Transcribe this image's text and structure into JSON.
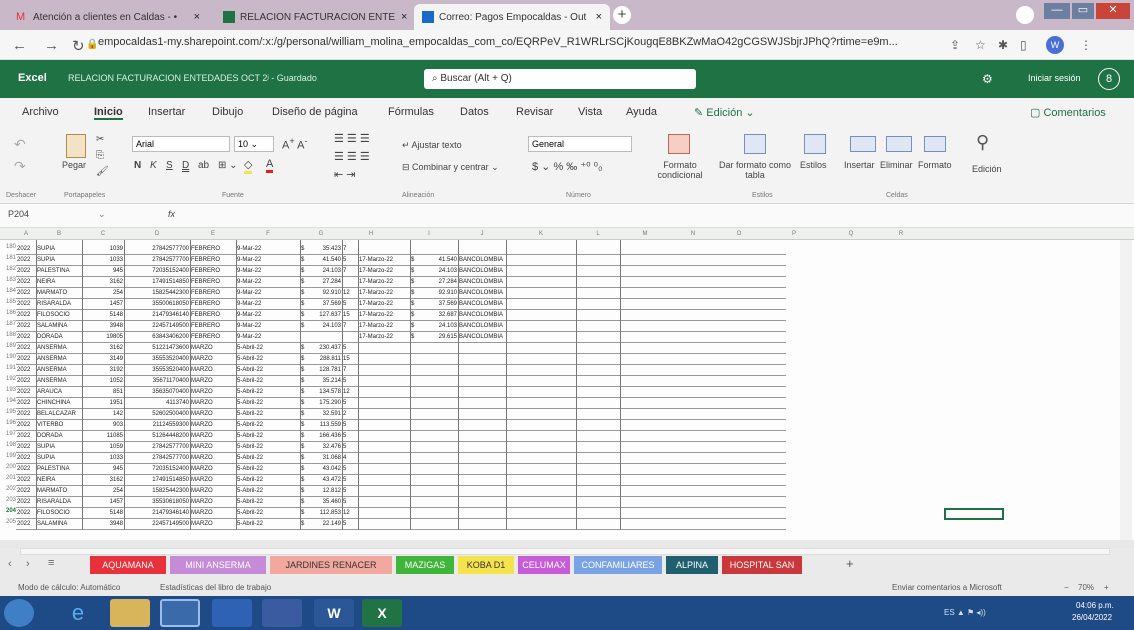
{
  "browser": {
    "tabs": [
      {
        "title": "Atención a clientes en Caldas - •",
        "close": "×"
      },
      {
        "title": "RELACION FACTURACION ENTE",
        "close": "×"
      },
      {
        "title": "Correo: Pagos Empocaldas - Out",
        "close": "×"
      }
    ],
    "new_tab": "+",
    "url": "empocaldas1-my.sharepoint.com/:x:/g/personal/william_molina_empocaldas_com_co/EQRPeV_R1WRLrSCjKougqE8BKZwMaO42gCGSWJSbjrJPhQ?rtime=e9m..."
  },
  "excel": {
    "app": "Excel",
    "doc": "RELACION FACTURACION ENTEDADES OCT 2ʲ - Guardado",
    "search": "Buscar (Alt + Q)",
    "signin": "Iniciar sesión"
  },
  "menu": [
    "Archivo",
    "Inicio",
    "Insertar",
    "Dibujo",
    "Diseño de página",
    "Fórmulas",
    "Datos",
    "Revisar",
    "Vista",
    "Ayuda"
  ],
  "mode": "Edición",
  "comments": "Comentarios",
  "ribbon": {
    "paste": "Pegar",
    "font": "Arial",
    "size": "10",
    "wrap": "Ajustar texto",
    "merge": "Combinar y centrar",
    "numfmt": "General",
    "cond": "Formato condicional",
    "astable": "Dar formato como tabla",
    "styles": "Estilos",
    "insert": "Insertar",
    "delete": "Eliminar",
    "format": "Formato",
    "edit": "Edición",
    "groups": [
      "Deshacer",
      "Portapapeles",
      "Fuente",
      "Alineación",
      "Número",
      "Estilos",
      "Celdas"
    ]
  },
  "namebox": "P204",
  "fx": "fx",
  "columns": [
    "A",
    "B",
    "C",
    "D",
    "E",
    "F",
    "G",
    "H",
    "I",
    "J",
    "K",
    "L",
    "M",
    "N",
    "O",
    "P",
    "Q",
    "R"
  ],
  "rows": [
    {
      "n": "180",
      "a": "2022",
      "b": "SUPIA",
      "c": "1039",
      "d": "27842577700",
      "e": "FEBRERO",
      "f": "9-Mar-22",
      "g": "35.423",
      "h": "7",
      "i": "",
      "j": "",
      "k": ""
    },
    {
      "n": "181",
      "a": "2022",
      "b": "SUPIA",
      "c": "1033",
      "d": "27842577700",
      "e": "FEBRERO",
      "f": "9-Mar-22",
      "g": "41.540",
      "h": "5",
      "i": "17-Marzo-22",
      "j": "41.540",
      "k": "BANCOLOMBIA"
    },
    {
      "n": "182",
      "a": "2022",
      "b": "PALESTINA",
      "c": "945",
      "d": "72035152400",
      "e": "FEBRERO",
      "f": "9-Mar-22",
      "g": "24.103",
      "h": "7",
      "i": "17-Marzo-22",
      "j": "24.103",
      "k": "BANCOLOMBIA"
    },
    {
      "n": "183",
      "a": "2022",
      "b": "NEIRA",
      "c": "3162",
      "d": "17491514850",
      "e": "FEBRERO",
      "f": "9-Mar-22",
      "g": "27.284",
      "h": "",
      "i": "17-Marzo-22",
      "j": "27.284",
      "k": "BANCOLOMBIA"
    },
    {
      "n": "184",
      "a": "2022",
      "b": "MARMATO",
      "c": "254",
      "d": "15825442300",
      "e": "FEBRERO",
      "f": "9-Mar-22",
      "g": "92.910",
      "h": "12",
      "i": "17-Marzo-22",
      "j": "92.910",
      "k": "BANCOLOMBIA"
    },
    {
      "n": "185",
      "a": "2022",
      "b": "RISARALDA",
      "c": "1457",
      "d": "35500618050",
      "e": "FEBRERO",
      "f": "9-Mar-22",
      "g": "37.569",
      "h": "5",
      "i": "17-Marzo-22",
      "j": "37.569",
      "k": "BANCOLOMBIA"
    },
    {
      "n": "186",
      "a": "2022",
      "b": "FILOSOCIO",
      "c": "5148",
      "d": "21479346140",
      "e": "FEBRERO",
      "f": "9-Mar-22",
      "g": "127.637",
      "h": "15",
      "i": "17-Marzo-22",
      "j": "32.687",
      "k": "BANCOLOMBIA"
    },
    {
      "n": "187",
      "a": "2022",
      "b": "SALAMINA",
      "c": "3948",
      "d": "22457149500",
      "e": "FEBRERO",
      "f": "9-Mar-22",
      "g": "24.103",
      "h": "7",
      "i": "17-Marzo-22",
      "j": "24.103",
      "k": "BANCOLOMBIA"
    },
    {
      "n": "188",
      "a": "2022",
      "b": "DORADA",
      "c": "19805",
      "d": "63843406200",
      "e": "FEBRERO",
      "f": "9-Mar-22",
      "g": "",
      "h": "",
      "i": "17-Marzo-22",
      "j": "29.615",
      "k": "BANCOLOMBIA"
    },
    {
      "n": "189",
      "a": "2022",
      "b": "ANSERMA",
      "c": "3162",
      "d": "51221473600",
      "e": "MARZO",
      "f": "5-Abril-22",
      "g": "230.437",
      "h": "5",
      "i": "",
      "j": "",
      "k": ""
    },
    {
      "n": "190",
      "a": "2022",
      "b": "ANSERMA",
      "c": "3149",
      "d": "35553520400",
      "e": "MARZO",
      "f": "5-Abril-22",
      "g": "288.811",
      "h": "15",
      "i": "",
      "j": "",
      "k": ""
    },
    {
      "n": "191",
      "a": "2022",
      "b": "ANSERMA",
      "c": "3192",
      "d": "35553520400",
      "e": "MARZO",
      "f": "5-Abril-22",
      "g": "128.781",
      "h": "7",
      "i": "",
      "j": "",
      "k": ""
    },
    {
      "n": "192",
      "a": "2022",
      "b": "ANSERMA",
      "c": "1052",
      "d": "35671170400",
      "e": "MARZO",
      "f": "5-Abril-22",
      "g": "35.214",
      "h": "5",
      "i": "",
      "j": "",
      "k": ""
    },
    {
      "n": "193",
      "a": "2022",
      "b": "ARAUCA",
      "c": "851",
      "d": "35635070400",
      "e": "MARZO",
      "f": "5-Abril-22",
      "g": "134.578",
      "h": "12",
      "i": "",
      "j": "",
      "k": ""
    },
    {
      "n": "194",
      "a": "2022",
      "b": "CHINCHINA",
      "c": "1951",
      "d": "4113740",
      "e": "MARZO",
      "f": "5-Abril-22",
      "g": "175.290",
      "h": "5",
      "i": "",
      "j": "",
      "k": ""
    },
    {
      "n": "195",
      "a": "2022",
      "b": "BELALCAZAR",
      "c": "142",
      "d": "52602500400",
      "e": "MARZO",
      "f": "5-Abril-22",
      "g": "32.591",
      "h": "2",
      "i": "",
      "j": "",
      "k": ""
    },
    {
      "n": "196",
      "a": "2022",
      "b": "VITERBO",
      "c": "903",
      "d": "21124559300",
      "e": "MARZO",
      "f": "5-Abril-22",
      "g": "113.559",
      "h": "5",
      "i": "",
      "j": "",
      "k": ""
    },
    {
      "n": "197",
      "a": "2022",
      "b": "DORADA",
      "c": "11085",
      "d": "51264448200",
      "e": "MARZO",
      "f": "5-Abril-22",
      "g": "166.436",
      "h": "5",
      "i": "",
      "j": "",
      "k": ""
    },
    {
      "n": "198",
      "a": "2022",
      "b": "SUPIA",
      "c": "1059",
      "d": "27842577700",
      "e": "MARZO",
      "f": "5-Abril-22",
      "g": "32.476",
      "h": "5",
      "i": "",
      "j": "",
      "k": ""
    },
    {
      "n": "199",
      "a": "2022",
      "b": "SUPIA",
      "c": "1033",
      "d": "27842577700",
      "e": "MARZO",
      "f": "5-Abril-22",
      "g": "31.068",
      "h": "4",
      "i": "",
      "j": "",
      "k": ""
    },
    {
      "n": "200",
      "a": "2022",
      "b": "PALESTINA",
      "c": "945",
      "d": "72035152400",
      "e": "MARZO",
      "f": "5-Abril-22",
      "g": "43.042",
      "h": "5",
      "i": "",
      "j": "",
      "k": ""
    },
    {
      "n": "201",
      "a": "2022",
      "b": "NEIRA",
      "c": "3162",
      "d": "17491514850",
      "e": "MARZO",
      "f": "5-Abril-22",
      "g": "43.472",
      "h": "5",
      "i": "",
      "j": "",
      "k": ""
    },
    {
      "n": "202",
      "a": "2022",
      "b": "MARMATO",
      "c": "254",
      "d": "15825442300",
      "e": "MARZO",
      "f": "5-Abril-22",
      "g": "12.812",
      "h": "5",
      "i": "",
      "j": "",
      "k": ""
    },
    {
      "n": "203",
      "a": "2022",
      "b": "RISARALDA",
      "c": "1457",
      "d": "35530618050",
      "e": "MARZO",
      "f": "5-Abril-22",
      "g": "35.460",
      "h": "5",
      "i": "",
      "j": "",
      "k": ""
    },
    {
      "n": "204",
      "a": "2022",
      "b": "FILOSOCIO",
      "c": "5148",
      "d": "21479346140",
      "e": "MARZO",
      "f": "5-Abril-22",
      "g": "112.853",
      "h": "12",
      "i": "",
      "j": "",
      "k": ""
    },
    {
      "n": "205",
      "a": "2022",
      "b": "SALAMINA",
      "c": "3948",
      "d": "22457149500",
      "e": "MARZO",
      "f": "5-Abril-22",
      "g": "22.149",
      "h": "5",
      "i": "",
      "j": "",
      "k": ""
    }
  ],
  "currency": "$",
  "sheets": [
    {
      "label": "AQUAMANA",
      "bg": "#e8313a",
      "fg": "#ffffff"
    },
    {
      "label": "MINI ANSERMA",
      "bg": "#c68bd6",
      "fg": "#ffffff"
    },
    {
      "label": "JARDINES RENACER",
      "bg": "#f2a79f",
      "fg": "#333333"
    },
    {
      "label": "MAZIGAS",
      "bg": "#3fb53a",
      "fg": "#ffffff"
    },
    {
      "label": "KOBA D1",
      "bg": "#f4e34a",
      "fg": "#333333"
    },
    {
      "label": "CELUMAX",
      "bg": "#c75bd8",
      "fg": "#ffffff"
    },
    {
      "label": "CONFAMILIARES",
      "bg": "#7aa3e6",
      "fg": "#ffffff"
    },
    {
      "label": "ALPINA",
      "bg": "#1f5f6e",
      "fg": "#ffffff"
    },
    {
      "label": "HOSPITAL SAN",
      "bg": "#c9383a",
      "fg": "#ffffff"
    }
  ],
  "add_sheet": "+",
  "status": {
    "calc": "Modo de cálculo: Automático",
    "stats": "Estadísticas del libro de trabajo",
    "feedback": "Enviar comentarios a Microsoft",
    "zoom": "70%"
  },
  "clock": {
    "time": "04:06 p.m.",
    "date": "26/04/2022"
  }
}
